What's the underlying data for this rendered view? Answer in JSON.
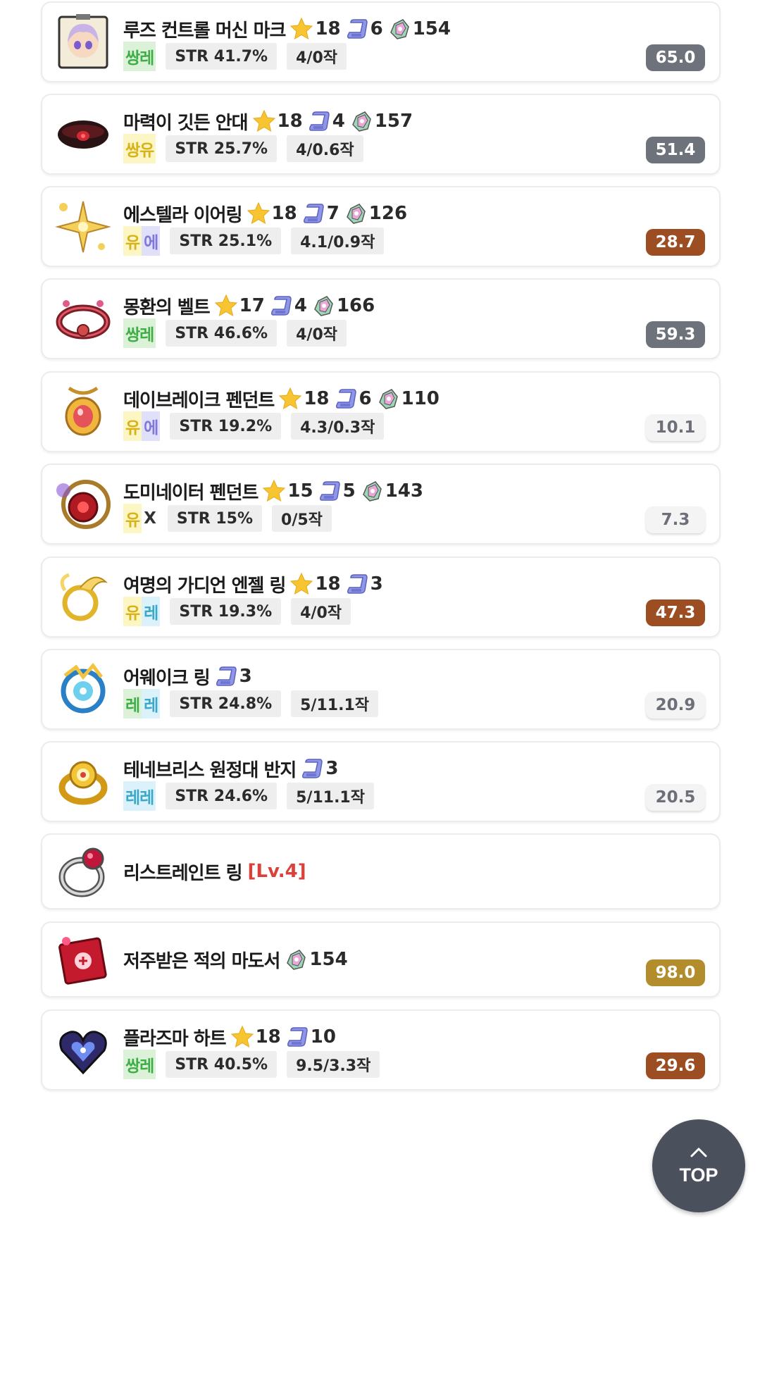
{
  "items": [
    {
      "name": "루즈 컨트롤 머신 마크",
      "level": "",
      "star": "18",
      "scroll": "6",
      "flame": "154",
      "potential": [
        {
          "text": "쌍레",
          "cls": "p-leg"
        }
      ],
      "stat": "STR 41.7%",
      "upgrade": "4/0작",
      "score": "65.0",
      "score_style": "sc-gray"
    },
    {
      "name": "마력이 깃든 안대",
      "level": "",
      "star": "18",
      "scroll": "4",
      "flame": "157",
      "potential": [
        {
          "text": "쌍유",
          "cls": "p-uni"
        }
      ],
      "stat": "STR 25.7%",
      "upgrade": "4/0.6작",
      "score": "51.4",
      "score_style": "sc-gray"
    },
    {
      "name": "에스텔라 이어링",
      "level": "",
      "star": "18",
      "scroll": "7",
      "flame": "126",
      "potential": [
        {
          "text": "유",
          "cls": "p-uni"
        },
        {
          "text": "에",
          "cls": "p-epi"
        }
      ],
      "stat": "STR 25.1%",
      "upgrade": "4.1/0.9작",
      "score": "28.7",
      "score_style": "sc-brown"
    },
    {
      "name": "몽환의 벨트",
      "level": "",
      "star": "17",
      "scroll": "4",
      "flame": "166",
      "potential": [
        {
          "text": "쌍레",
          "cls": "p-leg"
        }
      ],
      "stat": "STR 46.6%",
      "upgrade": "4/0작",
      "score": "59.3",
      "score_style": "sc-gray"
    },
    {
      "name": "데이브레이크 펜던트",
      "level": "",
      "star": "18",
      "scroll": "6",
      "flame": "110",
      "potential": [
        {
          "text": "유",
          "cls": "p-uni"
        },
        {
          "text": "에",
          "cls": "p-epi"
        }
      ],
      "stat": "STR 19.2%",
      "upgrade": "4.3/0.3작",
      "score": "10.1",
      "score_style": "sc-light"
    },
    {
      "name": "도미네이터 펜던트",
      "level": "",
      "star": "15",
      "scroll": "5",
      "flame": "143",
      "potential": [
        {
          "text": "유",
          "cls": "p-uni"
        },
        {
          "text": "X",
          "cls": "p-none"
        }
      ],
      "stat": "STR 15%",
      "upgrade": "0/5작",
      "score": "7.3",
      "score_style": "sc-light"
    },
    {
      "name": "여명의 가디언 엔젤 링",
      "level": "",
      "star": "18",
      "scroll": "3",
      "flame": "",
      "potential": [
        {
          "text": "유",
          "cls": "p-uni"
        },
        {
          "text": "레",
          "cls": "p-rar"
        }
      ],
      "stat": "STR 19.3%",
      "upgrade": "4/0작",
      "score": "47.3",
      "score_style": "sc-brown"
    },
    {
      "name": "어웨이크 링",
      "level": "",
      "star": "",
      "scroll": "3",
      "flame": "",
      "potential": [
        {
          "text": "레",
          "cls": "p-leg"
        },
        {
          "text": "레",
          "cls": "p-rar"
        }
      ],
      "stat": "STR 24.8%",
      "upgrade": "5/11.1작",
      "score": "20.9",
      "score_style": "sc-light"
    },
    {
      "name": "테네브리스 원정대 반지",
      "level": "",
      "star": "",
      "scroll": "3",
      "flame": "",
      "potential": [
        {
          "text": "레레",
          "cls": "p-rar"
        }
      ],
      "stat": "STR 24.6%",
      "upgrade": "5/11.1작",
      "score": "20.5",
      "score_style": "sc-light"
    },
    {
      "name": "리스트레인트 링",
      "level": "[Lv.4]",
      "star": "",
      "scroll": "",
      "flame": "",
      "potential": [],
      "stat": "",
      "upgrade": "",
      "score": "",
      "score_style": ""
    },
    {
      "name": "저주받은 적의 마도서",
      "level": "",
      "star": "",
      "scroll": "",
      "flame": "154",
      "potential": [],
      "stat": "",
      "upgrade": "",
      "score": "98.0",
      "score_style": "sc-gold"
    },
    {
      "name": "플라즈마 하트",
      "level": "",
      "star": "18",
      "scroll": "10",
      "flame": "",
      "potential": [
        {
          "text": "쌍레",
          "cls": "p-leg"
        }
      ],
      "stat": "STR 40.5%",
      "upgrade": "9.5/3.3작",
      "score": "29.6",
      "score_style": "sc-brown"
    }
  ],
  "icons": [
    "machine-mark-icon",
    "eye-patch-icon",
    "estella-earring-icon",
    "dream-belt-icon",
    "daybreak-pendant-icon",
    "dominator-pendant-icon",
    "guardian-angel-ring-icon",
    "awake-ring-icon",
    "tenebris-ring-icon",
    "restraint-ring-icon",
    "cursed-spellbook-icon",
    "plasma-heart-icon"
  ],
  "top_button": {
    "label": "TOP"
  }
}
